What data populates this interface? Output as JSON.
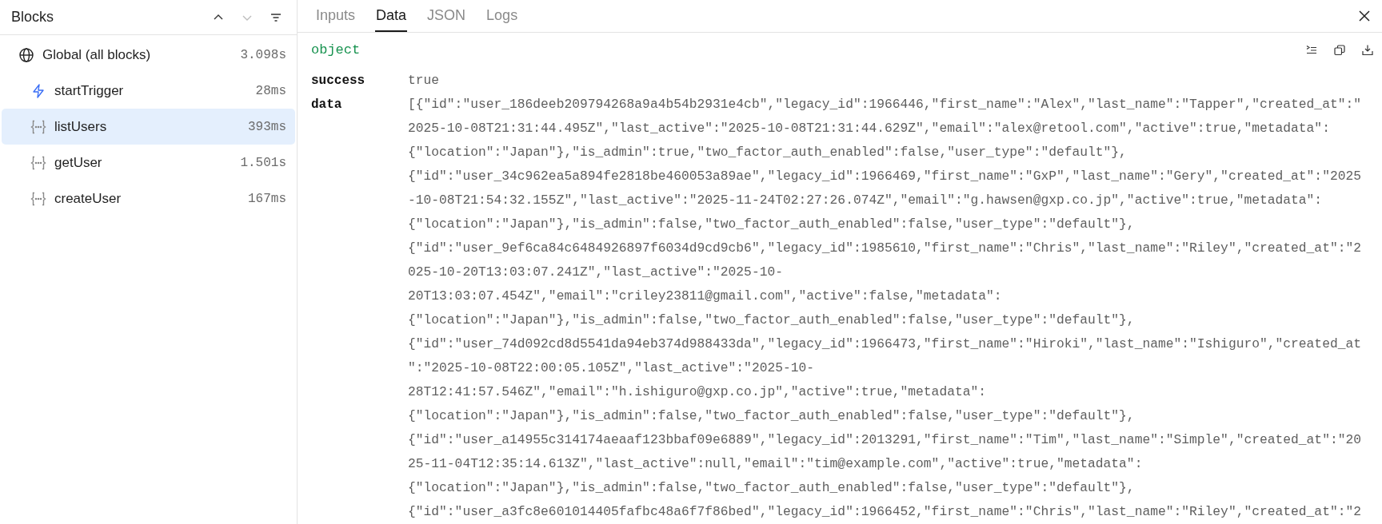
{
  "sidebar": {
    "title": "Blocks",
    "controls": [
      {
        "kind": "up",
        "disabled": false
      },
      {
        "kind": "down",
        "disabled": true
      },
      {
        "kind": "filter",
        "disabled": false
      }
    ],
    "items": [
      {
        "kind": "global",
        "label": "Global (all blocks)",
        "time": "3.098s",
        "selected": false,
        "children": [
          {
            "kind": "trigger",
            "label": "startTrigger",
            "time": "28ms",
            "selected": false
          },
          {
            "kind": "block",
            "label": "listUsers",
            "time": "393ms",
            "selected": true
          },
          {
            "kind": "block",
            "label": "getUser",
            "time": "1.501s",
            "selected": false
          },
          {
            "kind": "block",
            "label": "createUser",
            "time": "167ms",
            "selected": false
          }
        ]
      }
    ]
  },
  "tabs": [
    {
      "label": "Inputs",
      "selected": false
    },
    {
      "label": "Data",
      "selected": true
    },
    {
      "label": "JSON",
      "selected": false
    },
    {
      "label": "Logs",
      "selected": false
    }
  ],
  "panel": {
    "type_label": "object",
    "actions": [
      {
        "kind": "wrap"
      },
      {
        "kind": "copy"
      },
      {
        "kind": "download"
      }
    ],
    "fields": [
      {
        "key": "success",
        "lines": [
          "true"
        ]
      },
      {
        "key": "data",
        "lines": [
          "[{\"id\":\"user_186deeb209794268a9a4b54b2931e4cb\",\"legacy_id\":1966446,\"first_name\":\"Alex\",\"last_name\":\"Tapper\",\"created_at\":\"",
          "2025-10-08T21:31:44.495Z\",\"last_active\":\"2025-10-08T21:31:44.629Z\",\"email\":\"alex@retool.com\",\"active\":true,\"metadata\":",
          "{\"location\":\"Japan\"},\"is_admin\":true,\"two_factor_auth_enabled\":false,\"user_type\":\"default\"},",
          "{\"id\":\"user_34c962ea5a894fe2818be460053a89ae\",\"legacy_id\":1966469,\"first_name\":\"GxP\",\"last_name\":\"Gery\",\"created_at\":\"2025",
          "-10-08T21:54:32.155Z\",\"last_active\":\"2025-11-24T02:27:26.074Z\",\"email\":\"g.hawsen@gxp.co.jp\",\"active\":true,\"metadata\":",
          "{\"location\":\"Japan\"},\"is_admin\":false,\"two_factor_auth_enabled\":false,\"user_type\":\"default\"},",
          "{\"id\":\"user_9ef6ca84c6484926897f6034d9cd9cb6\",\"legacy_id\":1985610,\"first_name\":\"Chris\",\"last_name\":\"Riley\",\"created_at\":\"2",
          "025-10-20T13:03:07.241Z\",\"last_active\":\"2025-10-",
          "20T13:03:07.454Z\",\"email\":\"criley23811@gmail.com\",\"active\":false,\"metadata\":",
          "{\"location\":\"Japan\"},\"is_admin\":false,\"two_factor_auth_enabled\":false,\"user_type\":\"default\"},",
          "{\"id\":\"user_74d092cd8d5541da94eb374d988433da\",\"legacy_id\":1966473,\"first_name\":\"Hiroki\",\"last_name\":\"Ishiguro\",\"created_at",
          "\":\"2025-10-08T22:00:05.105Z\",\"last_active\":\"2025-10-",
          "28T12:41:57.546Z\",\"email\":\"h.ishiguro@gxp.co.jp\",\"active\":true,\"metadata\":",
          "{\"location\":\"Japan\"},\"is_admin\":false,\"two_factor_auth_enabled\":false,\"user_type\":\"default\"},",
          "{\"id\":\"user_a14955c314174aeaaf123bbaf09e6889\",\"legacy_id\":2013291,\"first_name\":\"Tim\",\"last_name\":\"Simple\",\"created_at\":\"20",
          "25-11-04T12:35:14.613Z\",\"last_active\":null,\"email\":\"tim@example.com\",\"active\":true,\"metadata\":",
          "{\"location\":\"Japan\"},\"is_admin\":false,\"two_factor_auth_enabled\":false,\"user_type\":\"default\"},",
          "{\"id\":\"user_a3fc8e601014405fafbc48a6f7f86bed\",\"legacy_id\":1966452,\"first_name\":\"Chris\",\"last_name\":\"Riley\",\"created_at\":\"2"
        ]
      }
    ]
  }
}
